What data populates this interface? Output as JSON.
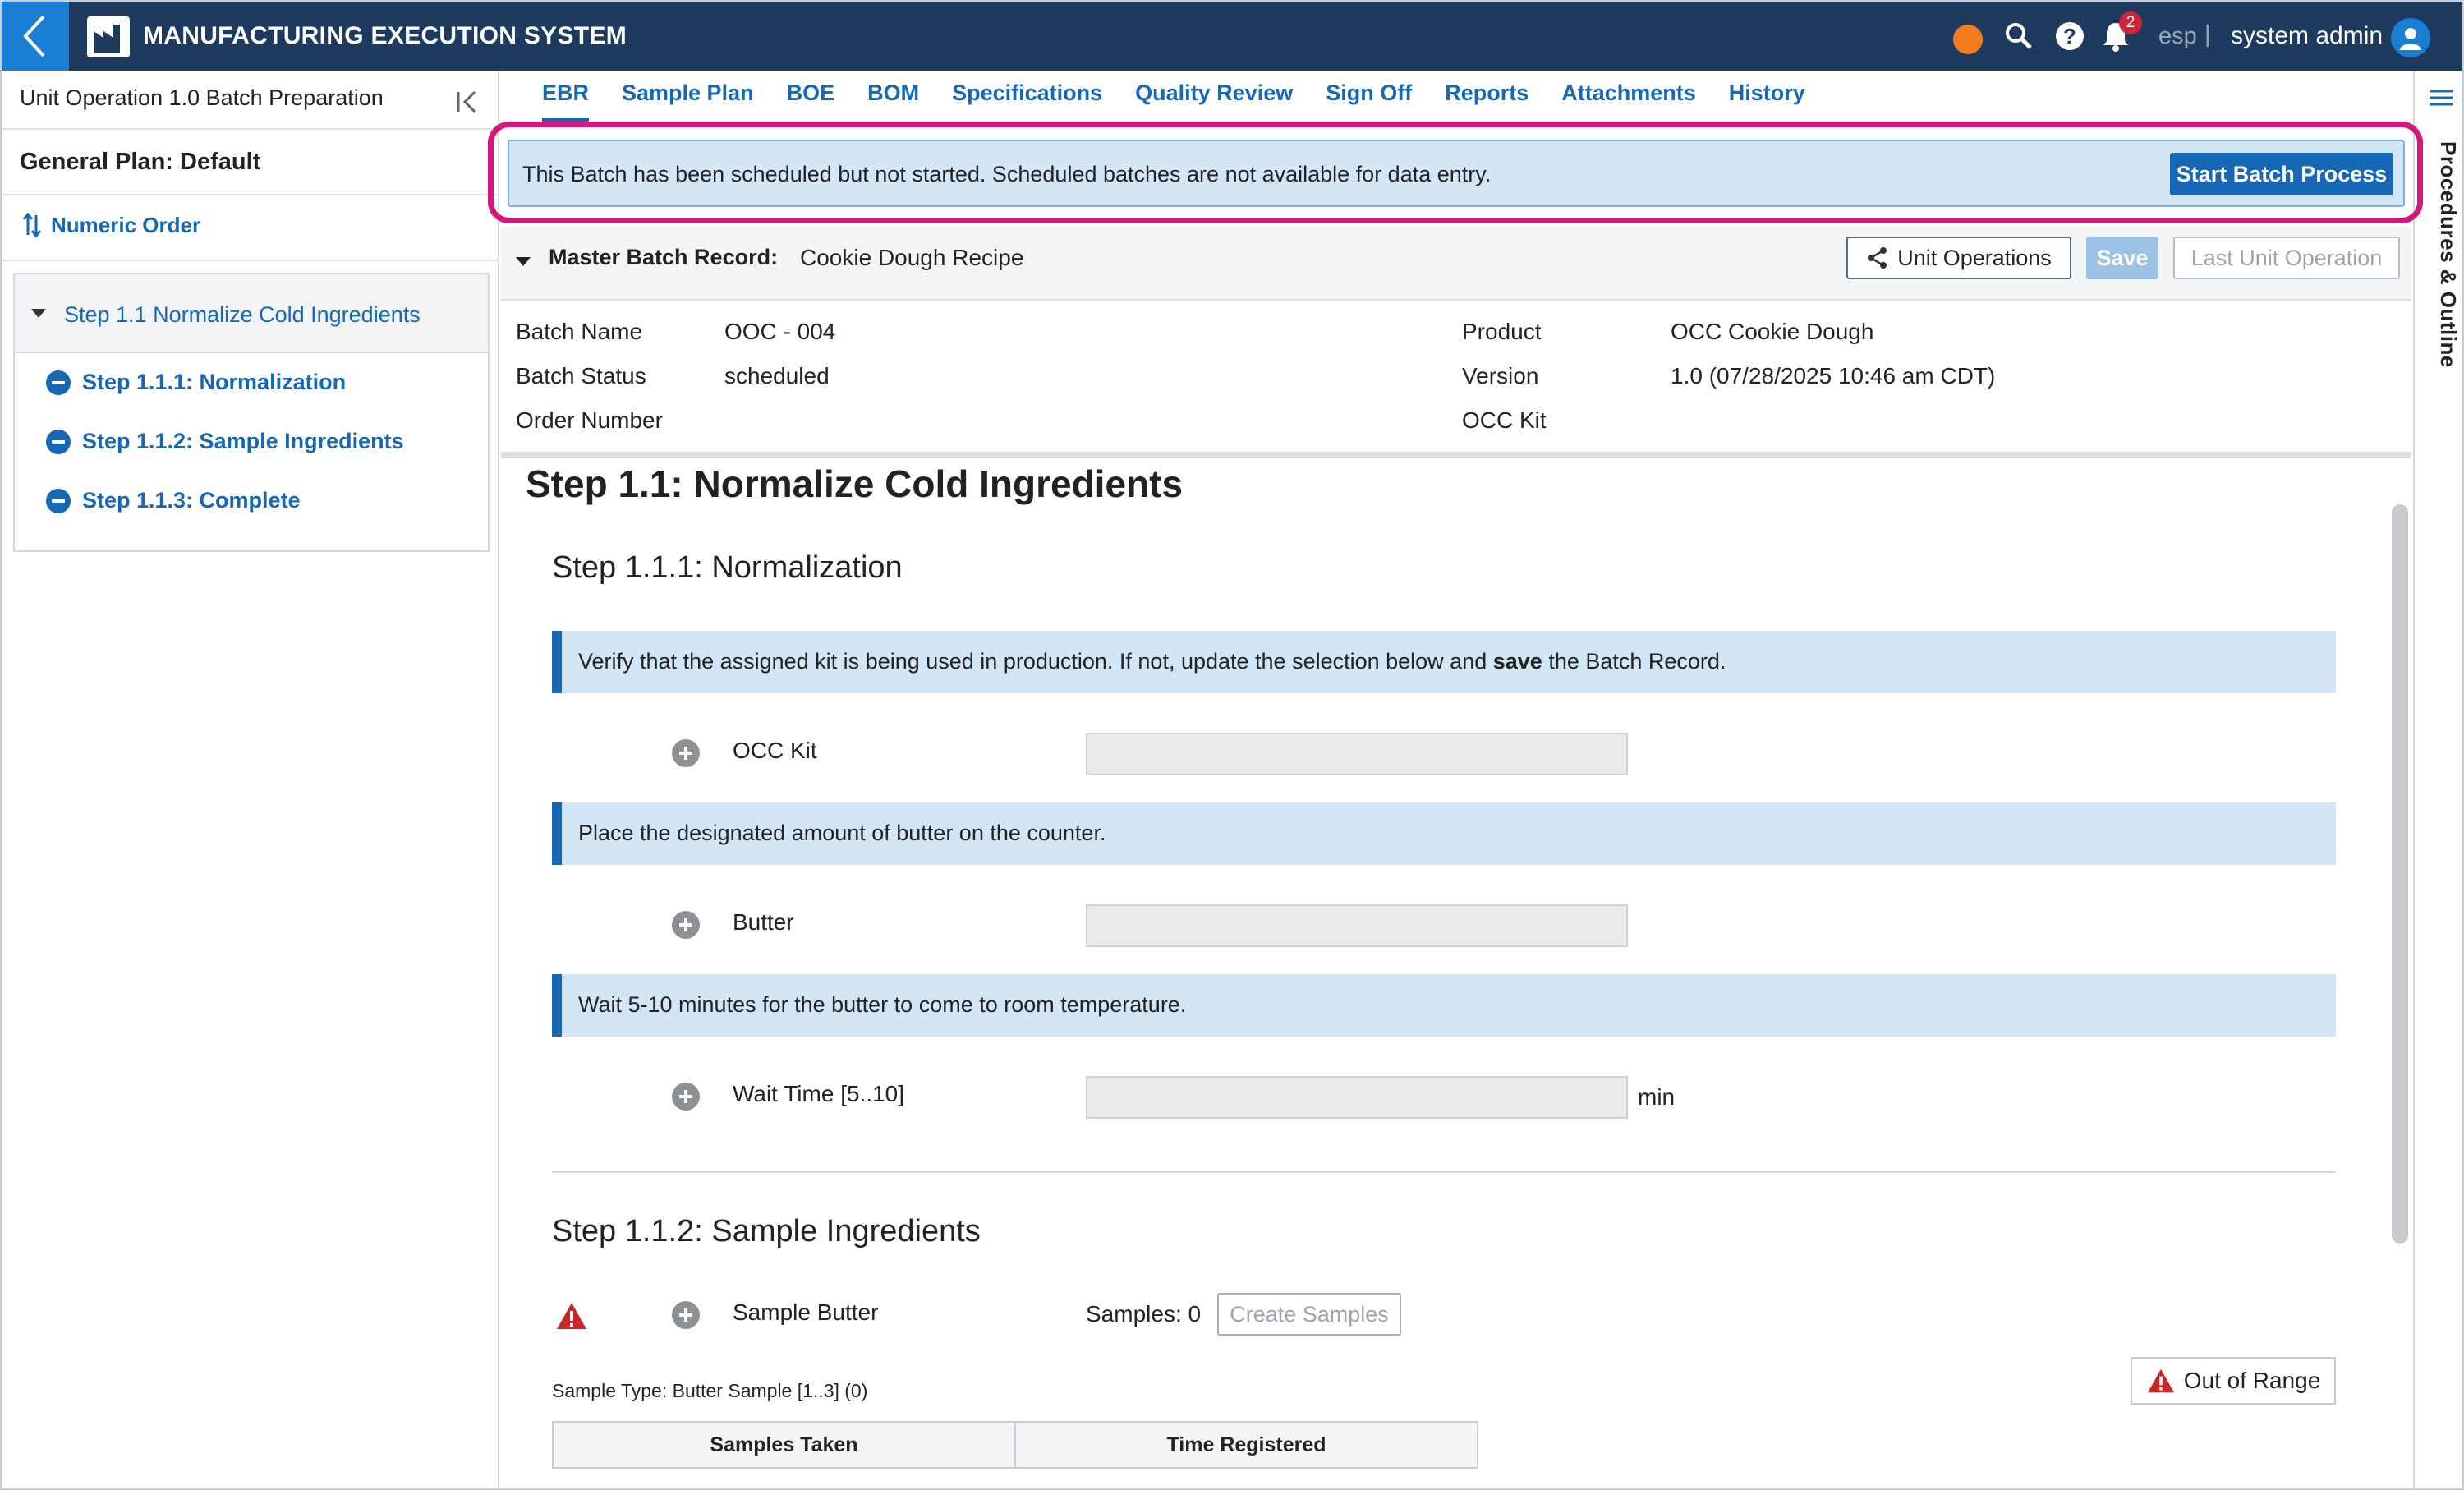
{
  "header": {
    "app_title": "MANUFACTURING EXECUTION SYSTEM",
    "notification_count": "2",
    "language": "esp",
    "separator": "|",
    "user_name": "system admin",
    "status_dot_color": "#f57c1f"
  },
  "sidebar": {
    "title": "Unit Operation 1.0 Batch Preparation",
    "plan": "General Plan: Default",
    "order_link": "Numeric Order",
    "tree": {
      "parent": "Step 1.1 Normalize Cold Ingredients",
      "children": [
        {
          "label": "Step 1.1.1: Normalization"
        },
        {
          "label": "Step 1.1.2: Sample Ingredients"
        },
        {
          "label": "Step 1.1.3: Complete"
        }
      ]
    }
  },
  "tabs": [
    {
      "label": "EBR",
      "active": true
    },
    {
      "label": "Sample Plan"
    },
    {
      "label": "BOE"
    },
    {
      "label": "BOM"
    },
    {
      "label": "Specifications"
    },
    {
      "label": "Quality Review"
    },
    {
      "label": "Sign Off"
    },
    {
      "label": "Reports"
    },
    {
      "label": "Attachments"
    },
    {
      "label": "History"
    }
  ],
  "right_rail": {
    "label": "Procedures & Outline"
  },
  "banner": {
    "message": "This Batch has been scheduled but not started. Scheduled batches are not available for data entry.",
    "button": "Start Batch Process"
  },
  "mbr": {
    "label": "Master Batch Record:",
    "value": "Cookie Dough Recipe",
    "unit_operations": "Unit Operations",
    "save": "Save",
    "last_unit_operation": "Last Unit Operation"
  },
  "batch_info": {
    "batch_name_label": "Batch Name",
    "batch_name": "OOC - 004",
    "batch_status_label": "Batch Status",
    "batch_status": "scheduled",
    "order_number_label": "Order Number",
    "order_number": "",
    "product_label": "Product",
    "product": "OCC Cookie Dough",
    "version_label": "Version",
    "version": "1.0 (07/28/2025 10:46 am CDT)",
    "kit_label": "OCC Kit",
    "kit": ""
  },
  "content": {
    "step_title": "Step 1.1: Normalize Cold Ingredients",
    "sub1": {
      "title": "Step 1.1.1: Normalization",
      "instr1_pre": "Verify that the assigned kit is being used in production. If not, update the selection below and ",
      "instr1_bold": "save",
      "instr1_post": " the Batch Record.",
      "field1": "OCC Kit",
      "instr2": "Place the designated amount of butter on the counter.",
      "field2": "Butter",
      "instr3": "Wait 5-10 minutes for the butter to come to room temperature.",
      "field3": "Wait Time [5..10]",
      "field3_unit": "min"
    },
    "sub2": {
      "title": "Step 1.1.2: Sample Ingredients",
      "field": "Sample Butter",
      "samples_count": "Samples: 0",
      "create_button": "Create Samples",
      "out_of_range": "Out of Range",
      "sample_type": "Sample Type: Butter Sample [1..3] (0)",
      "table_headers": [
        "Samples Taken",
        "Time Registered"
      ]
    }
  }
}
